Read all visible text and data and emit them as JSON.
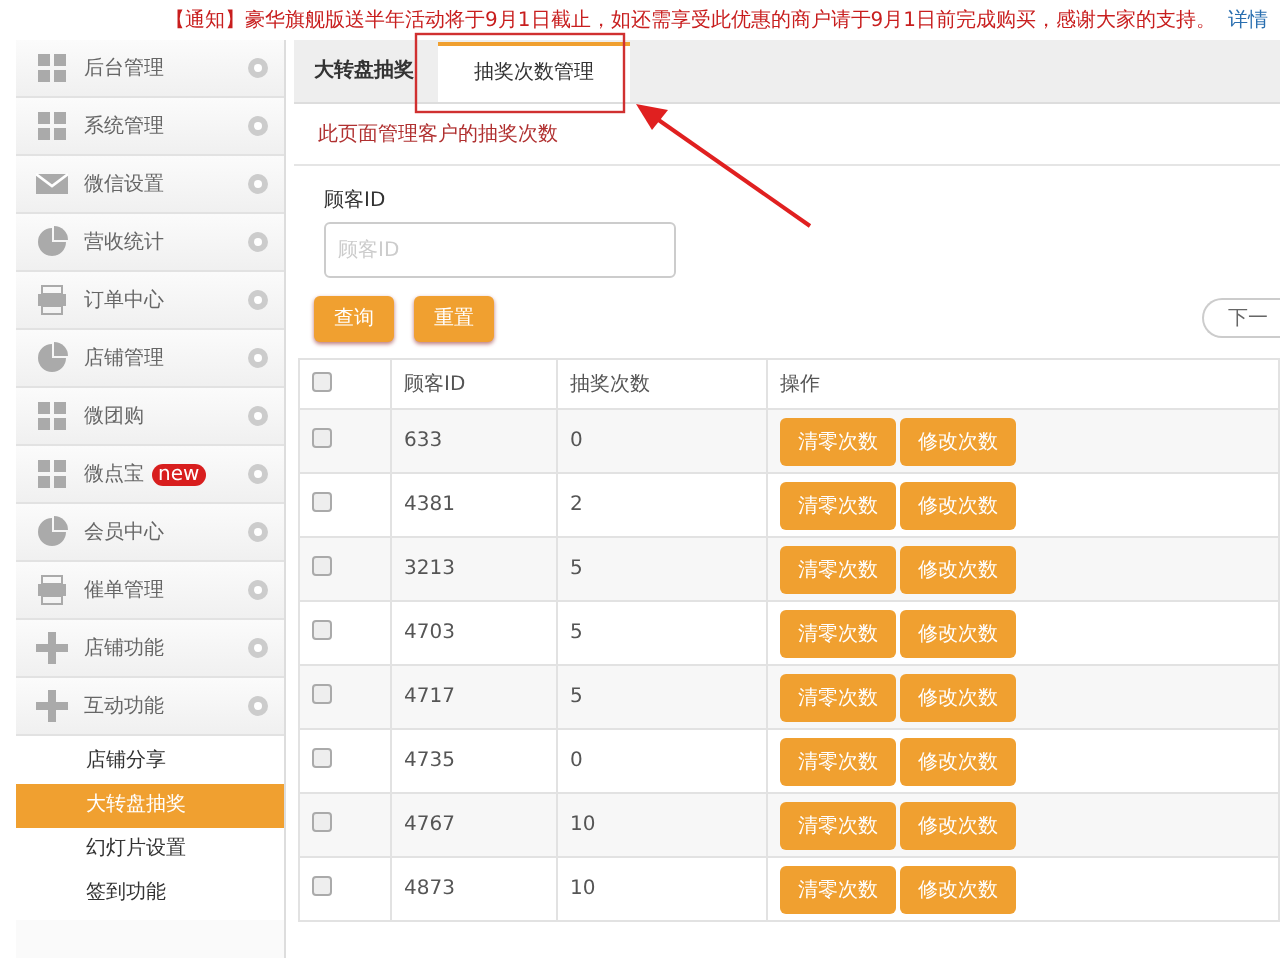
{
  "notice": {
    "text": "【通知】豪华旗舰版送半年活动将于9月1日截止，如还需享受此优惠的商户请于9月1日前完成购买，感谢大家的支持。",
    "link": "详情"
  },
  "sidebar": {
    "items": [
      {
        "label": "后台管理"
      },
      {
        "label": "系统管理"
      },
      {
        "label": "微信设置"
      },
      {
        "label": "营收统计"
      },
      {
        "label": "订单中心"
      },
      {
        "label": "店铺管理"
      },
      {
        "label": "微团购"
      },
      {
        "label": "微点宝",
        "badge": "new"
      },
      {
        "label": "会员中心"
      },
      {
        "label": "催单管理"
      },
      {
        "label": "店铺功能"
      },
      {
        "label": "互动功能",
        "children": [
          {
            "label": "店铺分享",
            "selected": false
          },
          {
            "label": "大转盘抽奖",
            "selected": true
          },
          {
            "label": "幻灯片设置",
            "selected": false
          },
          {
            "label": "签到功能",
            "selected": false
          }
        ]
      }
    ]
  },
  "tabs": [
    {
      "label": "大转盘抽奖",
      "selected": false
    },
    {
      "label": "抽奖次数管理",
      "selected": true
    }
  ],
  "description": "此页面管理客户的抽奖次数",
  "filter": {
    "label": "顾客ID",
    "placeholder": "顾客ID",
    "buttons": [
      "查询",
      "重置"
    ],
    "next_page": "下一"
  },
  "table": {
    "columns": [
      "顾客ID",
      "抽奖次数",
      "操作"
    ],
    "header_checked": false,
    "rows": [
      {
        "checked": false,
        "id": "633",
        "count": "0",
        "actions": [
          "清零次数",
          "修改次数"
        ]
      },
      {
        "checked": false,
        "id": "4381",
        "count": "2",
        "actions": [
          "清零次数",
          "修改次数"
        ]
      },
      {
        "checked": false,
        "id": "3213",
        "count": "5",
        "actions": [
          "清零次数",
          "修改次数"
        ]
      },
      {
        "checked": false,
        "id": "4703",
        "count": "5",
        "actions": [
          "清零次数",
          "修改次数"
        ]
      },
      {
        "checked": false,
        "id": "4717",
        "count": "5",
        "actions": [
          "清零次数",
          "修改次数"
        ]
      },
      {
        "checked": false,
        "id": "4735",
        "count": "0",
        "actions": [
          "清零次数",
          "修改次数"
        ]
      },
      {
        "checked": false,
        "id": "4767",
        "count": "10",
        "actions": [
          "清零次数",
          "修改次数"
        ]
      },
      {
        "checked": false,
        "id": "4873",
        "count": "10",
        "actions": [
          "清零次数",
          "修改次数"
        ]
      }
    ]
  }
}
